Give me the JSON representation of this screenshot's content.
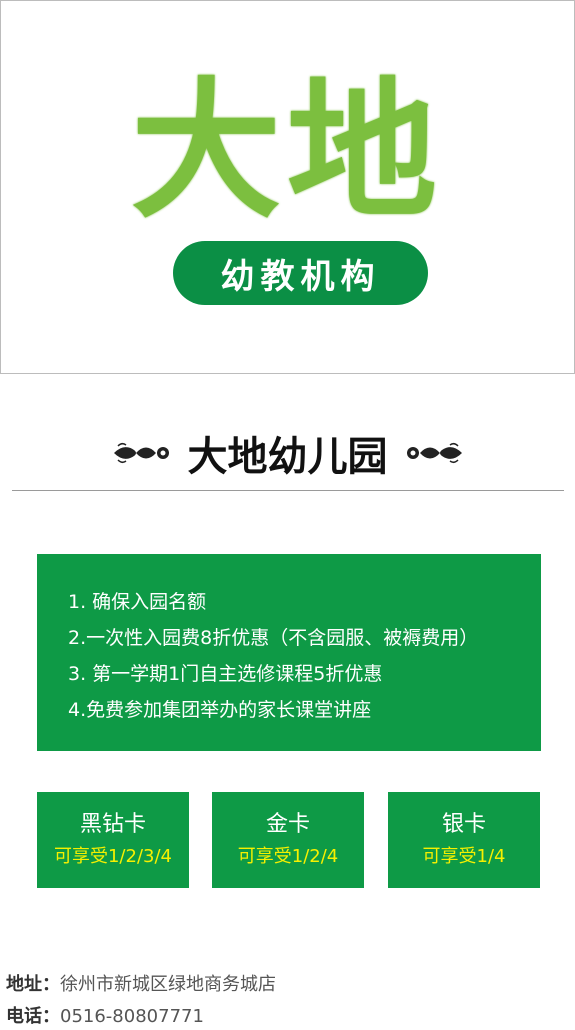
{
  "logo": {
    "main": "大地",
    "sub": "幼教机构"
  },
  "title": "大地幼儿园",
  "benefits": [
    "1. 确保入园名额",
    "2.一次性入园费8折优惠（不含园服、被褥费用）",
    "3. 第一学期1门自主选修课程5折优惠",
    "4.免费参加集团举办的家长课堂讲座"
  ],
  "cards": [
    {
      "name": "黑钻卡",
      "note": "可享受1/2/3/4"
    },
    {
      "name": "金卡",
      "note": "可享受1/2/4"
    },
    {
      "name": "银卡",
      "note": "可享受1/4"
    }
  ],
  "footer": {
    "address_label": "地址：",
    "address": "徐州市新城区绿地商务城店",
    "phone_label": "电话：",
    "phone": "0516-80807771"
  },
  "colors": {
    "logo_green": "#7cbf3f",
    "logo_dark_green": "#0b8f45",
    "panel_green": "#0e9a46",
    "note_yellow": "#f6f000"
  }
}
